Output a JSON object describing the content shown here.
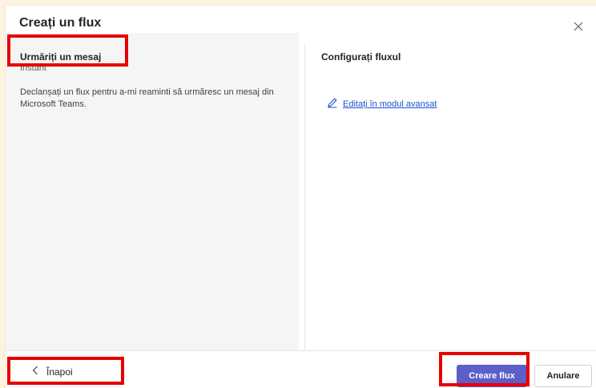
{
  "dialog": {
    "title": "Creați un flux"
  },
  "flow": {
    "name": "Urmăriți un mesaj",
    "type": "Instant",
    "description": "Declanșați un flux pentru a-mi reaminti să urmăresc un mesaj din Microsoft Teams."
  },
  "config": {
    "title": "Configurați fluxul",
    "edit_link": "Editați în modul avansat"
  },
  "footer": {
    "back_label": "Înapoi",
    "create_label": "Creare flux",
    "cancel_label": "Anulare"
  },
  "colors": {
    "accent": "#5b5fc7",
    "highlight": "#e60000",
    "link": "#1f4fd1"
  },
  "icons": [
    "close-icon",
    "pencil-icon",
    "chevron-left-icon"
  ]
}
